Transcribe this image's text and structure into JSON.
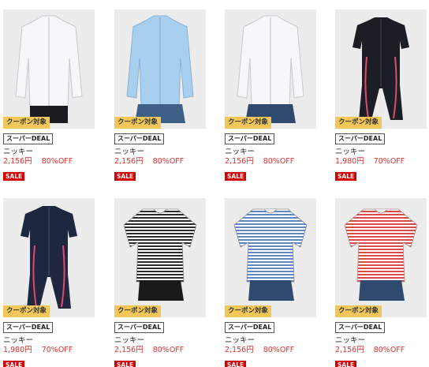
{
  "products": [
    {
      "coupon": "クーポン対象",
      "deal": "スーパーDEAL",
      "brand": "ニッキー",
      "price": "2,156円",
      "discount": "80%OFF",
      "sale": "SALE"
    },
    {
      "coupon": "クーポン対象",
      "deal": "スーパーDEAL",
      "brand": "ニッキー",
      "price": "2,156円",
      "discount": "80%OFF",
      "sale": "SALE"
    },
    {
      "coupon": "クーポン対象",
      "deal": "スーパーDEAL",
      "brand": "ニッキー",
      "price": "2,156円",
      "discount": "80%OFF",
      "sale": "SALE"
    },
    {
      "coupon": "クーポン対象",
      "deal": "スーパーDEAL",
      "brand": "ニッキー",
      "price": "1,980円",
      "discount": "70%OFF",
      "sale": "SALE"
    },
    {
      "coupon": "クーポン対象",
      "deal": "スーパーDEAL",
      "brand": "ニッキー",
      "price": "1,980円",
      "discount": "70%OFF",
      "sale": "SALE"
    },
    {
      "coupon": "クーポン対象",
      "deal": "スーパーDEAL",
      "brand": "ニッキー",
      "price": "2,156円",
      "discount": "80%OFF",
      "sale": "SALE"
    },
    {
      "coupon": "クーポン対象",
      "deal": "スーパーDEAL",
      "brand": "ニッキー",
      "price": "2,156円",
      "discount": "80%OFF",
      "sale": "SALE"
    },
    {
      "coupon": "クーポン対象",
      "deal": "スーパーDEAL",
      "brand": "ニッキー",
      "price": "2,156円",
      "discount": "80%OFF",
      "sale": "SALE"
    }
  ],
  "colors": {
    "coupon_badge": "#f2c75a",
    "price_text": "#e0312c",
    "sale_badge": "#d60000"
  }
}
